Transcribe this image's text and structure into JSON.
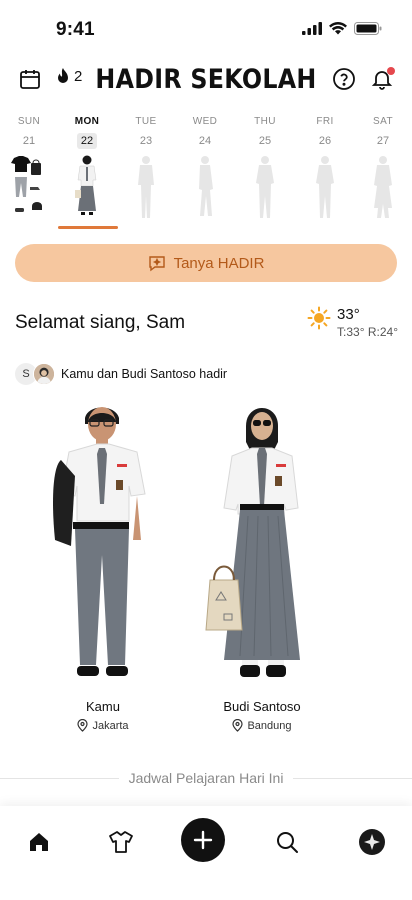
{
  "status_bar": {
    "time": "9:41"
  },
  "header": {
    "title": "HADIR SEKOLAH",
    "streak_count": "2",
    "calendar_icon": "calendar-icon",
    "help_icon": "question-circle-icon",
    "bell_icon": "bell-icon",
    "notification_dot_color": "#e5484d"
  },
  "week": {
    "days": [
      {
        "name": "SUN",
        "num": "21",
        "state": "outfit-items"
      },
      {
        "name": "MON",
        "num": "22",
        "state": "selected"
      },
      {
        "name": "TUE",
        "num": "23",
        "state": "empty"
      },
      {
        "name": "WED",
        "num": "24",
        "state": "empty"
      },
      {
        "name": "THU",
        "num": "25",
        "state": "empty"
      },
      {
        "name": "FRI",
        "num": "26",
        "state": "empty"
      },
      {
        "name": "SAT",
        "num": "27",
        "state": "empty"
      }
    ],
    "accent_color": "#e0793a"
  },
  "ask_button": {
    "label": "Tanya HADIR",
    "bg_color": "#f6c79f",
    "text_color": "#b35a1a"
  },
  "greeting": {
    "text": "Selamat siang, Sam"
  },
  "weather": {
    "temp": "33°",
    "range": "T:33° R:24°",
    "icon": "sun-icon"
  },
  "attendance": {
    "avatar_initial": "S",
    "text": "Kamu dan Budi Santoso hadir",
    "people": [
      {
        "name": "Kamu",
        "location": "Jakarta"
      },
      {
        "name": "Budi Santoso",
        "location": "Bandung"
      }
    ]
  },
  "schedule": {
    "label": "Jadwal Pelajaran Hari Ini"
  },
  "bottom_nav": {
    "items": [
      "home-icon",
      "shirt-icon",
      "add-icon",
      "search-icon",
      "profile-icon"
    ]
  }
}
